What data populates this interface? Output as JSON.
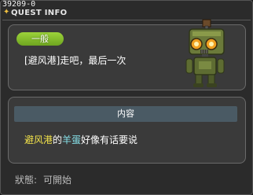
{
  "quest": {
    "id": "39209-0",
    "window_title": "QUEST INFO",
    "category_badge": "一般",
    "name": "[避风港]走吧，最后一次"
  },
  "details": {
    "section_title": "内容",
    "description_parts": [
      {
        "text": "避风港",
        "color": "#f2e24a"
      },
      {
        "text": "的",
        "color": "#ffffff"
      },
      {
        "text": "羊蛋",
        "color": "#86e0e8"
      },
      {
        "text": "好像有话要说",
        "color": "#ffffff"
      }
    ]
  },
  "status": {
    "label": "狀態:",
    "value": "可開始"
  },
  "npc": {
    "icon": "robot-npc-icon"
  },
  "colors": {
    "badge": "#86c12e",
    "location_highlight": "#f2e24a",
    "npc_highlight": "#86e0e8",
    "section_header": "#4a5a64"
  }
}
